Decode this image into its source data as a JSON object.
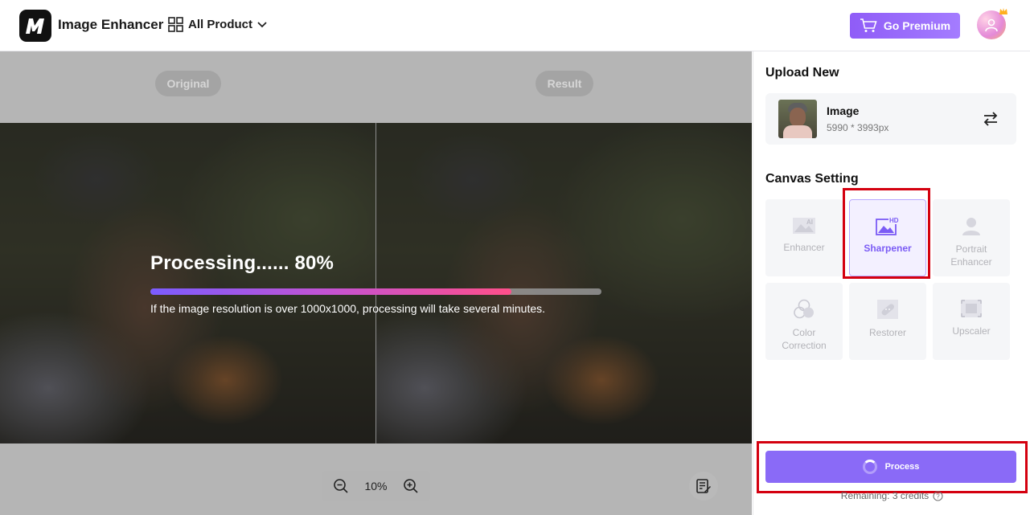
{
  "header": {
    "logo_text": "M",
    "app_title": "Image Enhancer",
    "all_product_label": "All Product",
    "premium_label": "Go Premium"
  },
  "canvas": {
    "original_label": "Original",
    "result_label": "Result",
    "processing_title": "Processing...... 80%",
    "progress": 0.8,
    "hint": "If the image resolution is over 1000x1000, processing will take several minutes.",
    "zoom_level": "10%"
  },
  "sidebar": {
    "upload_title": "Upload New",
    "image_name": "Image",
    "image_dims": "5990 * 3993px",
    "canvas_setting_title": "Canvas Setting",
    "tools": [
      {
        "label": "Enhancer",
        "icon": "enhancer-ai-icon",
        "active": false
      },
      {
        "label": "Sharpener",
        "icon": "sharpener-hd-icon",
        "active": true
      },
      {
        "label": "Portrait\nEnhancer",
        "icon": "portrait-icon",
        "active": false
      },
      {
        "label": "Color\nCorrection",
        "icon": "color-correction-icon",
        "active": false
      },
      {
        "label": "Restorer",
        "icon": "restorer-icon",
        "active": false
      },
      {
        "label": "Upscaler",
        "icon": "upscaler-icon",
        "active": false
      }
    ],
    "process_label": "Process",
    "remaining_text": "Remaining: 3 credits"
  },
  "colors": {
    "accent": "#8a6af7",
    "highlight": "#d4000f"
  }
}
